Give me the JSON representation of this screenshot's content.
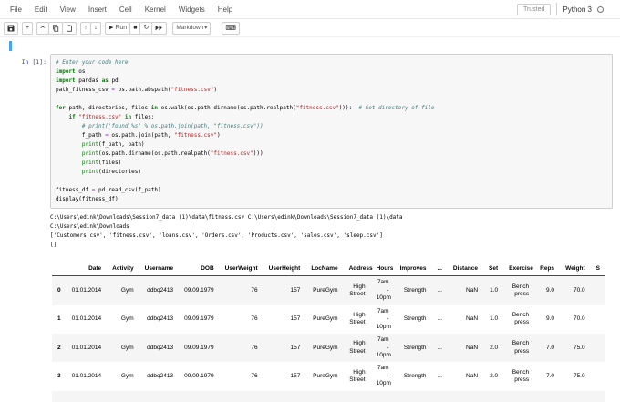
{
  "menu": {
    "items": [
      "File",
      "Edit",
      "View",
      "Insert",
      "Cell",
      "Kernel",
      "Widgets",
      "Help"
    ]
  },
  "header_right": {
    "trusted_label": "Trusted",
    "kernel_name": "Python 3"
  },
  "toolbar": {
    "cell_type_value": "Markdown",
    "groups": [
      [
        {
          "id": "save-button",
          "icon": "floppy-icon",
          "glyph": "svg:floppy"
        }
      ],
      [
        {
          "id": "insert-cell-below-button",
          "icon": "plus-icon",
          "glyph": "+"
        }
      ],
      [
        {
          "id": "cut-cells-button",
          "icon": "scissors-icon",
          "glyph": "✂"
        },
        {
          "id": "copy-cells-button",
          "icon": "copy-icon",
          "glyph": "svg:copy"
        },
        {
          "id": "paste-cells-button",
          "icon": "paste-icon",
          "glyph": "svg:paste"
        }
      ],
      [
        {
          "id": "move-cell-up-button",
          "icon": "arrow-up-icon",
          "glyph": "↑"
        },
        {
          "id": "move-cell-down-button",
          "icon": "arrow-down-icon",
          "glyph": "↓"
        }
      ],
      [
        {
          "id": "run-button",
          "icon": "play-icon",
          "glyph": "▶",
          "label": "Run"
        },
        {
          "id": "interrupt-kernel-button",
          "icon": "stop-icon",
          "glyph": "■"
        },
        {
          "id": "restart-kernel-button",
          "icon": "restart-icon",
          "glyph": "↻"
        },
        {
          "id": "restart-run-all-button",
          "icon": "fast-forward-icon",
          "glyph": "svg:ffwd"
        }
      ]
    ],
    "command_palette": {
      "id": "command-palette-button",
      "icon": "keyboard-icon",
      "glyph": "⌨"
    }
  },
  "cell": {
    "prompt": "In [1]:",
    "code_lines": [
      [
        [
          "c",
          "# Enter your code here"
        ]
      ],
      [
        [
          "k",
          "import"
        ],
        [
          "p",
          " os"
        ]
      ],
      [
        [
          "k",
          "import"
        ],
        [
          "p",
          " pandas "
        ],
        [
          "k",
          "as"
        ],
        [
          "p",
          " pd"
        ]
      ],
      [
        [
          "p",
          "path_fitness_csv "
        ],
        [
          "o",
          "="
        ],
        [
          "p",
          " os.path.abspath("
        ],
        [
          "s",
          "\"fitness.csv\""
        ],
        [
          "p",
          ")"
        ]
      ],
      [],
      [
        [
          "k",
          "for"
        ],
        [
          "p",
          " path, directories, files "
        ],
        [
          "k",
          "in"
        ],
        [
          "p",
          " os.walk(os.path.dirname(os.path.realpath("
        ],
        [
          "s",
          "\"fitness.csv\""
        ],
        [
          "p",
          "))):  "
        ],
        [
          "c",
          "# Get directory of file"
        ]
      ],
      [
        [
          "p",
          "    "
        ],
        [
          "k",
          "if"
        ],
        [
          "p",
          " "
        ],
        [
          "s",
          "\"fitness.csv\""
        ],
        [
          "p",
          " "
        ],
        [
          "k",
          "in"
        ],
        [
          "p",
          " files:"
        ]
      ],
      [
        [
          "p",
          "        "
        ],
        [
          "c",
          "# print('found %s' % os.path.join(path, \"fitness.csv\"))"
        ]
      ],
      [
        [
          "p",
          "        f_path "
        ],
        [
          "o",
          "="
        ],
        [
          "p",
          " os.path.join(path, "
        ],
        [
          "s",
          "\"fitness.csv\""
        ],
        [
          "p",
          ")"
        ]
      ],
      [
        [
          "p",
          "        "
        ],
        [
          "b",
          "print"
        ],
        [
          "p",
          "(f_path, path)"
        ]
      ],
      [
        [
          "p",
          "        "
        ],
        [
          "b",
          "print"
        ],
        [
          "p",
          "(os.path.dirname(os.path.realpath("
        ],
        [
          "s",
          "\"fitness.csv\""
        ],
        [
          "p",
          ")))"
        ]
      ],
      [
        [
          "p",
          "        "
        ],
        [
          "b",
          "print"
        ],
        [
          "p",
          "(files)"
        ]
      ],
      [
        [
          "p",
          "        "
        ],
        [
          "b",
          "print"
        ],
        [
          "p",
          "(directories)"
        ]
      ],
      [],
      [
        [
          "p",
          "fitness_df "
        ],
        [
          "o",
          "="
        ],
        [
          "p",
          " pd.read_csv(f_path)"
        ]
      ],
      [
        [
          "p",
          "display(fitness_df)"
        ]
      ]
    ]
  },
  "output": {
    "stdout_lines": [
      "C:\\Users\\edink\\Downloads\\Session7_data (1)\\data\\fitness.csv C:\\Users\\edink\\Downloads\\Session7_data (1)\\data",
      "C:\\Users\\edink\\Downloads",
      "['Customers.csv', 'fitness.csv', 'loans.csv', 'Orders.csv', 'Products.csv', 'sales.csv', 'sleep.csv']",
      "[]"
    ]
  },
  "table": {
    "columns": [
      "",
      "Date",
      "Activity",
      "Username",
      "DOB",
      "UserWeight",
      "UserHeight",
      "LocName",
      "Address",
      "Hours",
      "Improves",
      "...",
      "Distance",
      "Set",
      "Exercise",
      "Reps",
      "Weight",
      "S"
    ],
    "rows": [
      [
        "0",
        "01.01.2014",
        "Gym",
        "ddbq2413",
        "09.09.1979",
        "76",
        "157",
        "PureGym",
        "High Street",
        "7am - 10pm",
        "Strength",
        "...",
        "NaN",
        "1.0",
        "Bench press",
        "9.0",
        "70.0",
        ""
      ],
      [
        "1",
        "01.01.2014",
        "Gym",
        "ddbq2413",
        "09.09.1979",
        "76",
        "157",
        "PureGym",
        "High Street",
        "7am - 10pm",
        "Strength",
        "...",
        "NaN",
        "1.0",
        "Bench press",
        "9.0",
        "70.0",
        ""
      ],
      [
        "2",
        "01.01.2014",
        "Gym",
        "ddbq2413",
        "09.09.1979",
        "76",
        "157",
        "PureGym",
        "High Street",
        "7am - 10pm",
        "Strength",
        "...",
        "NaN",
        "2.0",
        "Bench press",
        "7.0",
        "75.0",
        ""
      ],
      [
        "3",
        "01.01.2014",
        "Gym",
        "ddbq2413",
        "09.09.1979",
        "76",
        "157",
        "PureGym",
        "High Street",
        "7am - 10pm",
        "Strength",
        "...",
        "NaN",
        "2.0",
        "Bench press",
        "7.0",
        "75.0",
        ""
      ],
      [
        "",
        "",
        "",
        "",
        "",
        "",
        "",
        "",
        "",
        "",
        "",
        "",
        "",
        "",
        "",
        "",
        "",
        ""
      ]
    ]
  },
  "colors": {
    "selected_cell_accent": "#42a5f5",
    "prompt_blue": "#303f9f",
    "keyword_green": "#008000",
    "string_red": "#ba2121",
    "comment_teal": "#408080",
    "operator_purple": "#aa22ff",
    "stripe_gray": "#f5f5f5"
  }
}
